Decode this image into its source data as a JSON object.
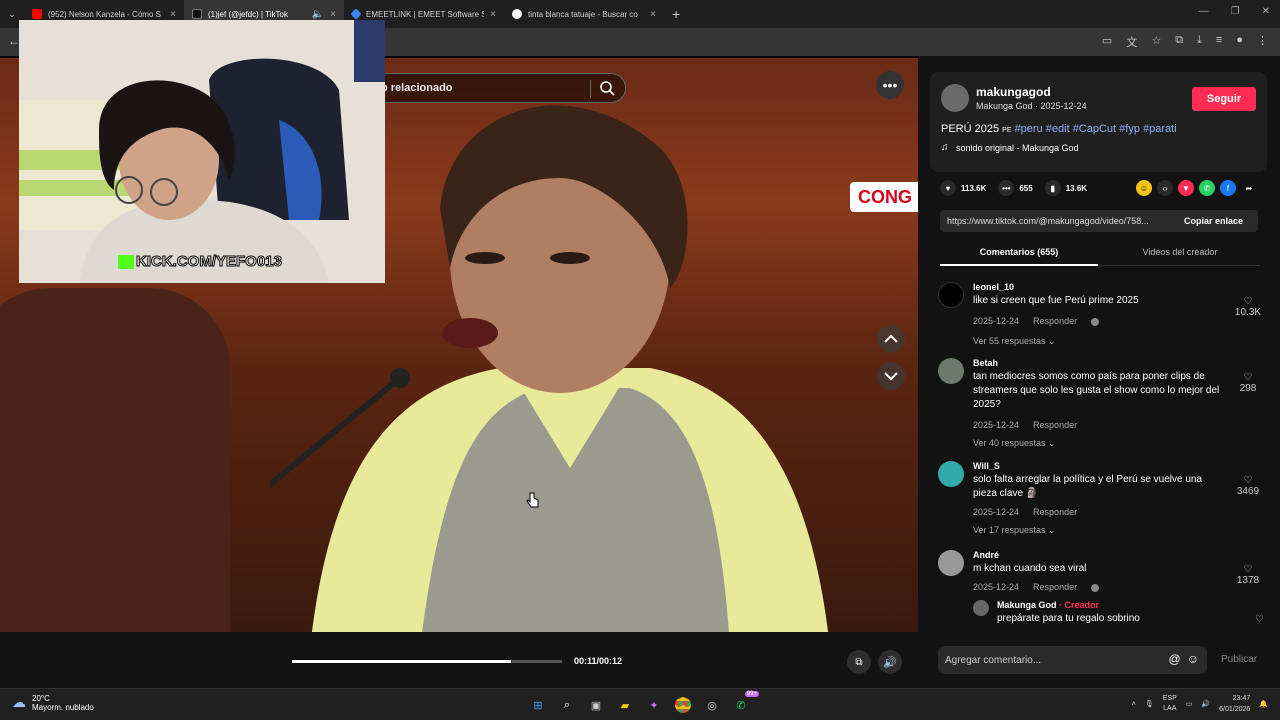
{
  "browser": {
    "tabs": [
      {
        "title": "(952) Nelson Kanzela - Cómo S",
        "color": "#ff0000"
      },
      {
        "title": "(1)jef (@jefdc) | TikTok",
        "color": "#111111",
        "active": true
      },
      {
        "title": "EMEETLINK | EMEET Software S",
        "color": "#3b82f6"
      },
      {
        "title": "tinta blanca tatuaje - Buscar co",
        "color": "#4285f4"
      }
    ],
    "new_tab": "+"
  },
  "video": {
    "search_text": "o relacionado",
    "overlay_channel": "CONG",
    "webcam_label": "KICK.COM/YEFO013",
    "time": "00:11/00:12",
    "progress": 0.81
  },
  "post": {
    "username": "makungagod",
    "subline": "Makunga God · 2025-12-24",
    "follow": "Seguir",
    "desc_prefix": "PERÚ 2025",
    "desc_flag": "PE",
    "hashtags": [
      "#peru",
      "#edit",
      "#CapCut",
      "#fyp",
      "#parati"
    ],
    "sound": "sonido original - Makunga God",
    "likes": "113.6K",
    "comments": "655",
    "saves": "13.6K",
    "url": "https://www.tiktok.com/@makungagod/video/758...",
    "copy_link": "Copiar enlace",
    "tab_comments": "Comentarios (655)",
    "tab_videos": "Videos del creador"
  },
  "comments": [
    {
      "name": "leonel_10",
      "text": "like si creen que fue Perú prime 2025",
      "date": "2025-12-24",
      "reply": "Responder",
      "likes": "10.3K",
      "more": "Ver 55 respuestas"
    },
    {
      "name": "Betah",
      "text": "tan mediocres somos como país para poner clips de streamers que solo les gusta el show como lo mejor del 2025?",
      "date": "2025-12-24",
      "reply": "Responder",
      "likes": "298",
      "more": "Ver 40 respuestas"
    },
    {
      "name": "Will_S",
      "text": "solo falta arreglar la política y el Perú se vuelve una pieza clave 🗿",
      "date": "2025-12-24",
      "reply": "Responder",
      "likes": "3469",
      "more": "Ver 17 respuestas"
    },
    {
      "name": "André",
      "text": "m kchan cuando sea viral",
      "date": "2025-12-24",
      "reply": "Responder",
      "likes": "1378",
      "more": ""
    }
  ],
  "creator_reply": {
    "name": "Makunga God",
    "badge": "· Creador",
    "text": "prepárate para tu regalo sobrino"
  },
  "add_comment": {
    "placeholder": "Agregar comentario...",
    "post": "Publicar"
  },
  "taskbar": {
    "temp": "20°C",
    "weather": "Mayorm. nublado",
    "badge": "99+",
    "lang1": "ESP",
    "lang2": "LAA",
    "time": "23:47",
    "date": "6/01/2026"
  }
}
